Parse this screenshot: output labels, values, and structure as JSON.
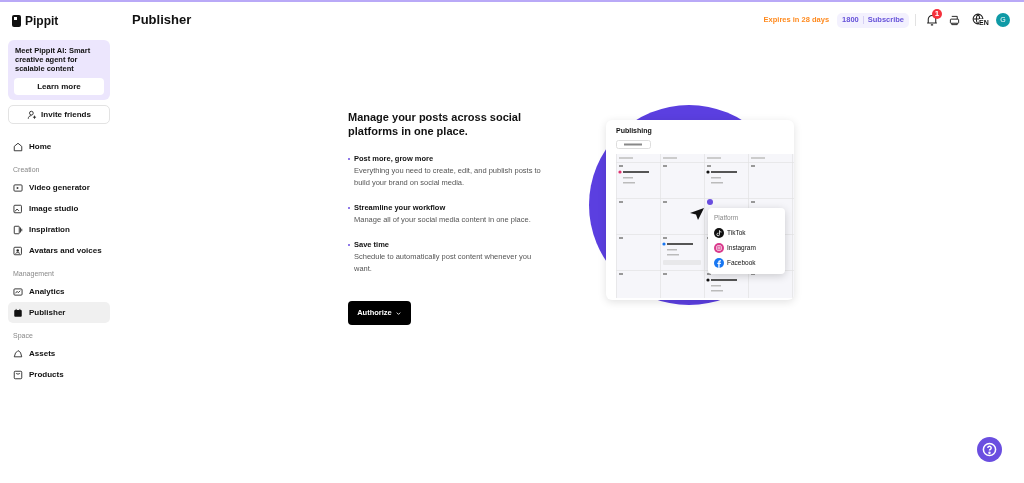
{
  "brand": "Pippit",
  "page_title": "Publisher",
  "promo": {
    "text": "Meet Pippit AI: Smart creative agent for scalable content",
    "button": "Learn more"
  },
  "invite": "Invite friends",
  "nav": [
    {
      "items": [
        {
          "label": "Home",
          "selected": false
        }
      ]
    },
    {
      "heading": "Creation",
      "items": [
        {
          "label": "Video generator",
          "selected": false
        },
        {
          "label": "Image studio",
          "selected": false
        },
        {
          "label": "Inspiration",
          "selected": false
        },
        {
          "label": "Avatars and voices",
          "selected": false
        }
      ]
    },
    {
      "heading": "Management",
      "items": [
        {
          "label": "Analytics",
          "selected": false
        },
        {
          "label": "Publisher",
          "selected": true
        }
      ]
    },
    {
      "heading": "Space",
      "items": [
        {
          "label": "Assets",
          "selected": false
        },
        {
          "label": "Products",
          "selected": false
        }
      ]
    }
  ],
  "header": {
    "expires": "Expires in 28 days",
    "credits": "1800",
    "subscribe": "Subscribe",
    "notifications": "1",
    "language": "EN",
    "avatar": "G"
  },
  "headline": "Manage your posts across social platforms in one place.",
  "features": [
    {
      "title": "Post more, grow more",
      "text": "Everything you need to create, edit, and publish posts to build your brand on social media."
    },
    {
      "title": "Streamline your workflow",
      "text": "Manage all of your social media content in one place."
    },
    {
      "title": "Save time",
      "text": "Schedule to automatically post content whenever you want."
    }
  ],
  "authorize": "Authorize",
  "illustration": {
    "title": "Publishing",
    "popup": {
      "title": "Platform",
      "options": [
        "TikTok",
        "Instagram",
        "Facebook"
      ]
    }
  }
}
